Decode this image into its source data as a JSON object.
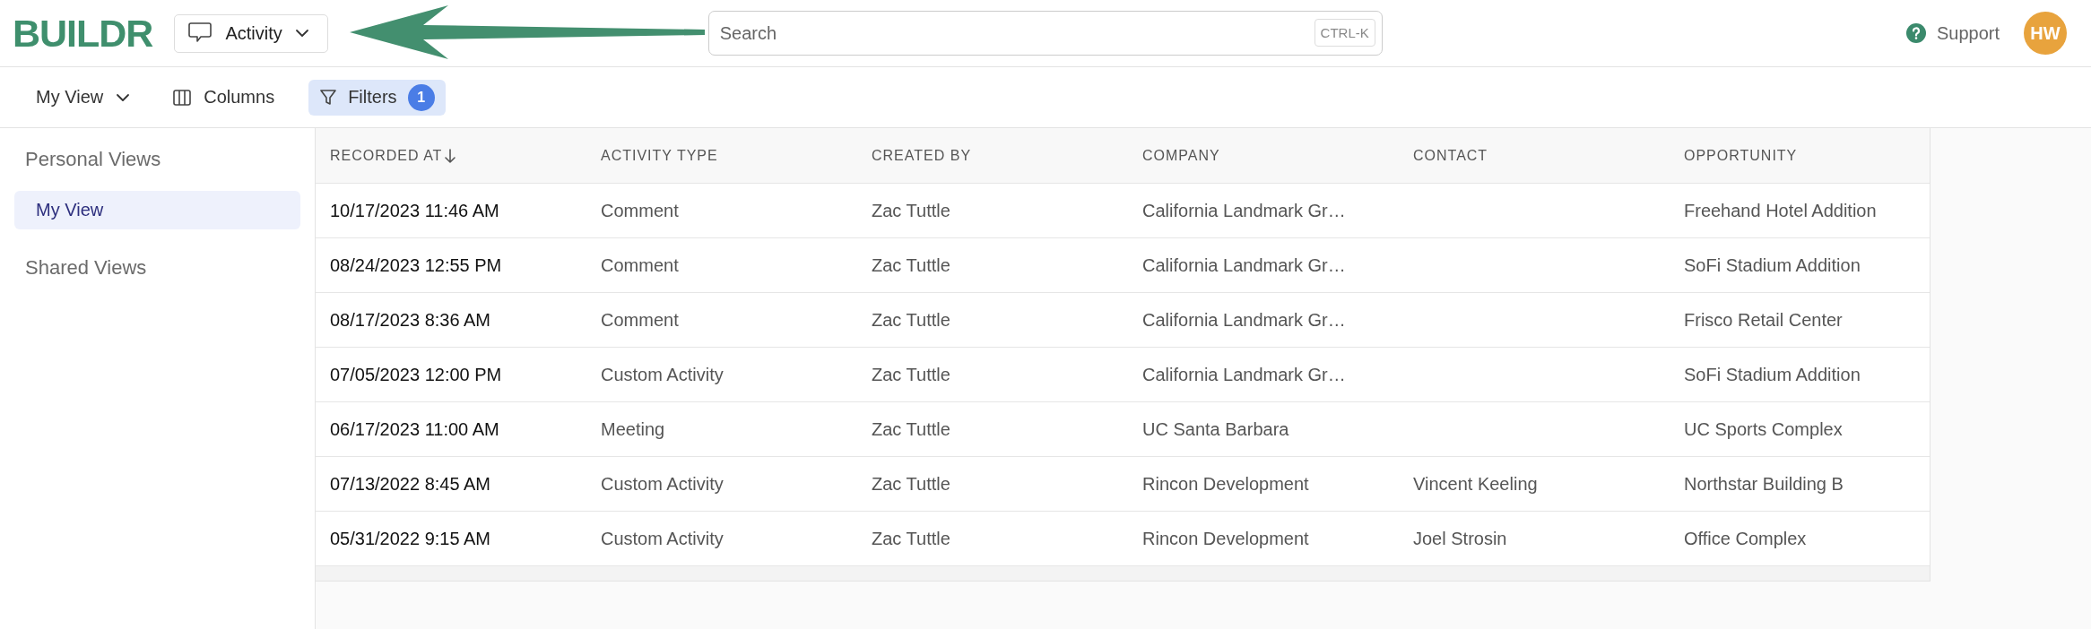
{
  "header": {
    "logo": "BUILDR",
    "module_button": {
      "label": "Activity"
    },
    "search": {
      "placeholder": "Search",
      "shortcut": "CTRL-K"
    },
    "support": {
      "label": "Support"
    },
    "avatar": {
      "initials": "HW"
    }
  },
  "toolbar": {
    "view_menu": {
      "label": "My View"
    },
    "columns_button": {
      "label": "Columns"
    },
    "filters_button": {
      "label": "Filters",
      "active": true,
      "count": "1"
    }
  },
  "sidebar": {
    "sections": [
      {
        "title": "Personal Views",
        "items": [
          {
            "label": "My View",
            "selected": true
          }
        ]
      },
      {
        "title": "Shared Views"
      }
    ]
  },
  "table": {
    "columns": [
      {
        "label": "RECORDED AT",
        "sorted_descending": true
      },
      {
        "label": "ACTIVITY TYPE",
        "sorted_descending": false
      },
      {
        "label": "CREATED BY",
        "sorted_descending": false
      },
      {
        "label": "COMPANY",
        "sorted_descending": false
      },
      {
        "label": "CONTACT",
        "sorted_descending": false
      },
      {
        "label": "OPPORTUNITY",
        "sorted_descending": false
      }
    ],
    "rows": [
      [
        "10/17/2023 11:46 AM",
        "Comment",
        "Zac Tuttle",
        "California Landmark Gr…",
        "",
        "Freehand Hotel Addition"
      ],
      [
        "08/24/2023 12:55 PM",
        "Comment",
        "Zac Tuttle",
        "California Landmark Gr…",
        "",
        "SoFi Stadium Addition"
      ],
      [
        "08/17/2023 8:36 AM",
        "Comment",
        "Zac Tuttle",
        "California Landmark Gr…",
        "",
        "Frisco Retail Center"
      ],
      [
        "07/05/2023 12:00 PM",
        "Custom Activity",
        "Zac Tuttle",
        "California Landmark Gr…",
        "",
        "SoFi Stadium Addition"
      ],
      [
        "06/17/2023 11:00 AM",
        "Meeting",
        "Zac Tuttle",
        "UC Santa Barbara",
        "",
        "UC Sports Complex"
      ],
      [
        "07/13/2022 8:45 AM",
        "Custom Activity",
        "Zac Tuttle",
        "Rincon Development",
        "Vincent Keeling",
        "Northstar Building B"
      ],
      [
        "05/31/2022 9:15 AM",
        "Custom Activity",
        "Zac Tuttle",
        "Rincon Development",
        "Joel Strosin",
        "Office Complex"
      ]
    ]
  }
}
